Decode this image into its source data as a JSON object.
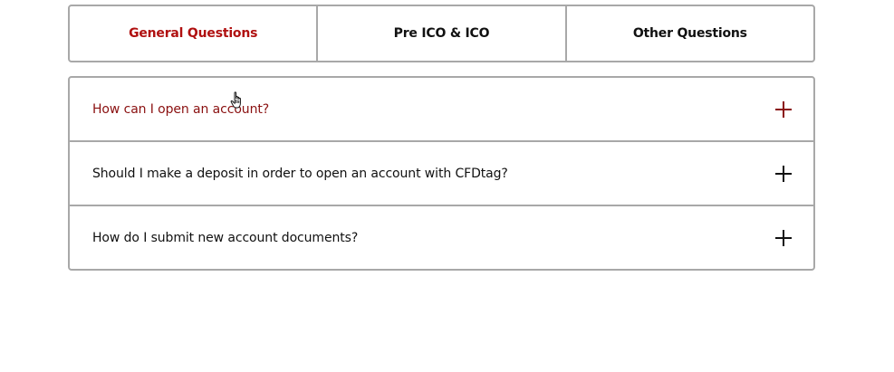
{
  "tabs": [
    {
      "label": "General Questions",
      "active": true
    },
    {
      "label": "Pre ICO & ICO",
      "active": false
    },
    {
      "label": "Other Questions",
      "active": false
    }
  ],
  "faq": [
    {
      "question": "How can I open an account?",
      "expanded_icon": "plus-icon",
      "hovered": true
    },
    {
      "question": "Should I make a deposit in order to open an account with CFDtag?",
      "expanded_icon": "plus-icon",
      "hovered": false
    },
    {
      "question": "How do I submit new account documents?",
      "expanded_icon": "plus-icon",
      "hovered": false
    }
  ],
  "colors": {
    "accent": "#b01010",
    "hover_text": "#8a1010",
    "border": "#a8a8a8"
  },
  "cursor_icon": "hand-pointer-icon"
}
